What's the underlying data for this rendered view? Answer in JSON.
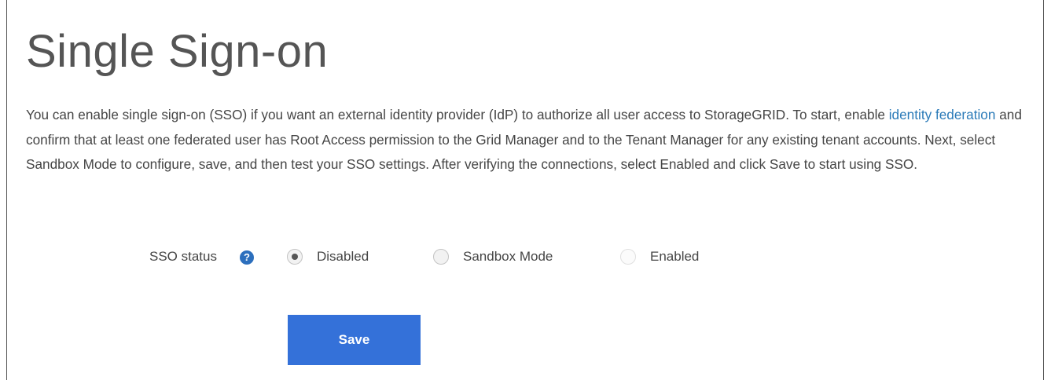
{
  "page": {
    "title": "Single Sign-on"
  },
  "description": {
    "part1": "You can enable single sign-on (SSO) if you want an external identity provider (IdP) to authorize all user access to StorageGRID. To start, enable ",
    "link_text": "identity federation",
    "part2": " and confirm that at least one federated user has Root Access permission to the Grid Manager and to the Tenant Manager for any existing tenant accounts. Next, select Sandbox Mode to configure, save, and then test your SSO settings. After verifying the connections, select Enabled and click Save to start using SSO."
  },
  "sso_status": {
    "label": "SSO status",
    "help_icon": "question-circle-icon",
    "help_glyph": "?",
    "options": [
      {
        "label": "Disabled",
        "selected": true,
        "disabled": false
      },
      {
        "label": "Sandbox Mode",
        "selected": false,
        "disabled": false
      },
      {
        "label": "Enabled",
        "selected": false,
        "disabled": true
      }
    ],
    "selected_value": "Disabled"
  },
  "actions": {
    "save_label": "Save"
  },
  "colors": {
    "primary_button": "#3471d9",
    "link": "#2a7ab8",
    "help_icon": "#2c6fbd"
  }
}
